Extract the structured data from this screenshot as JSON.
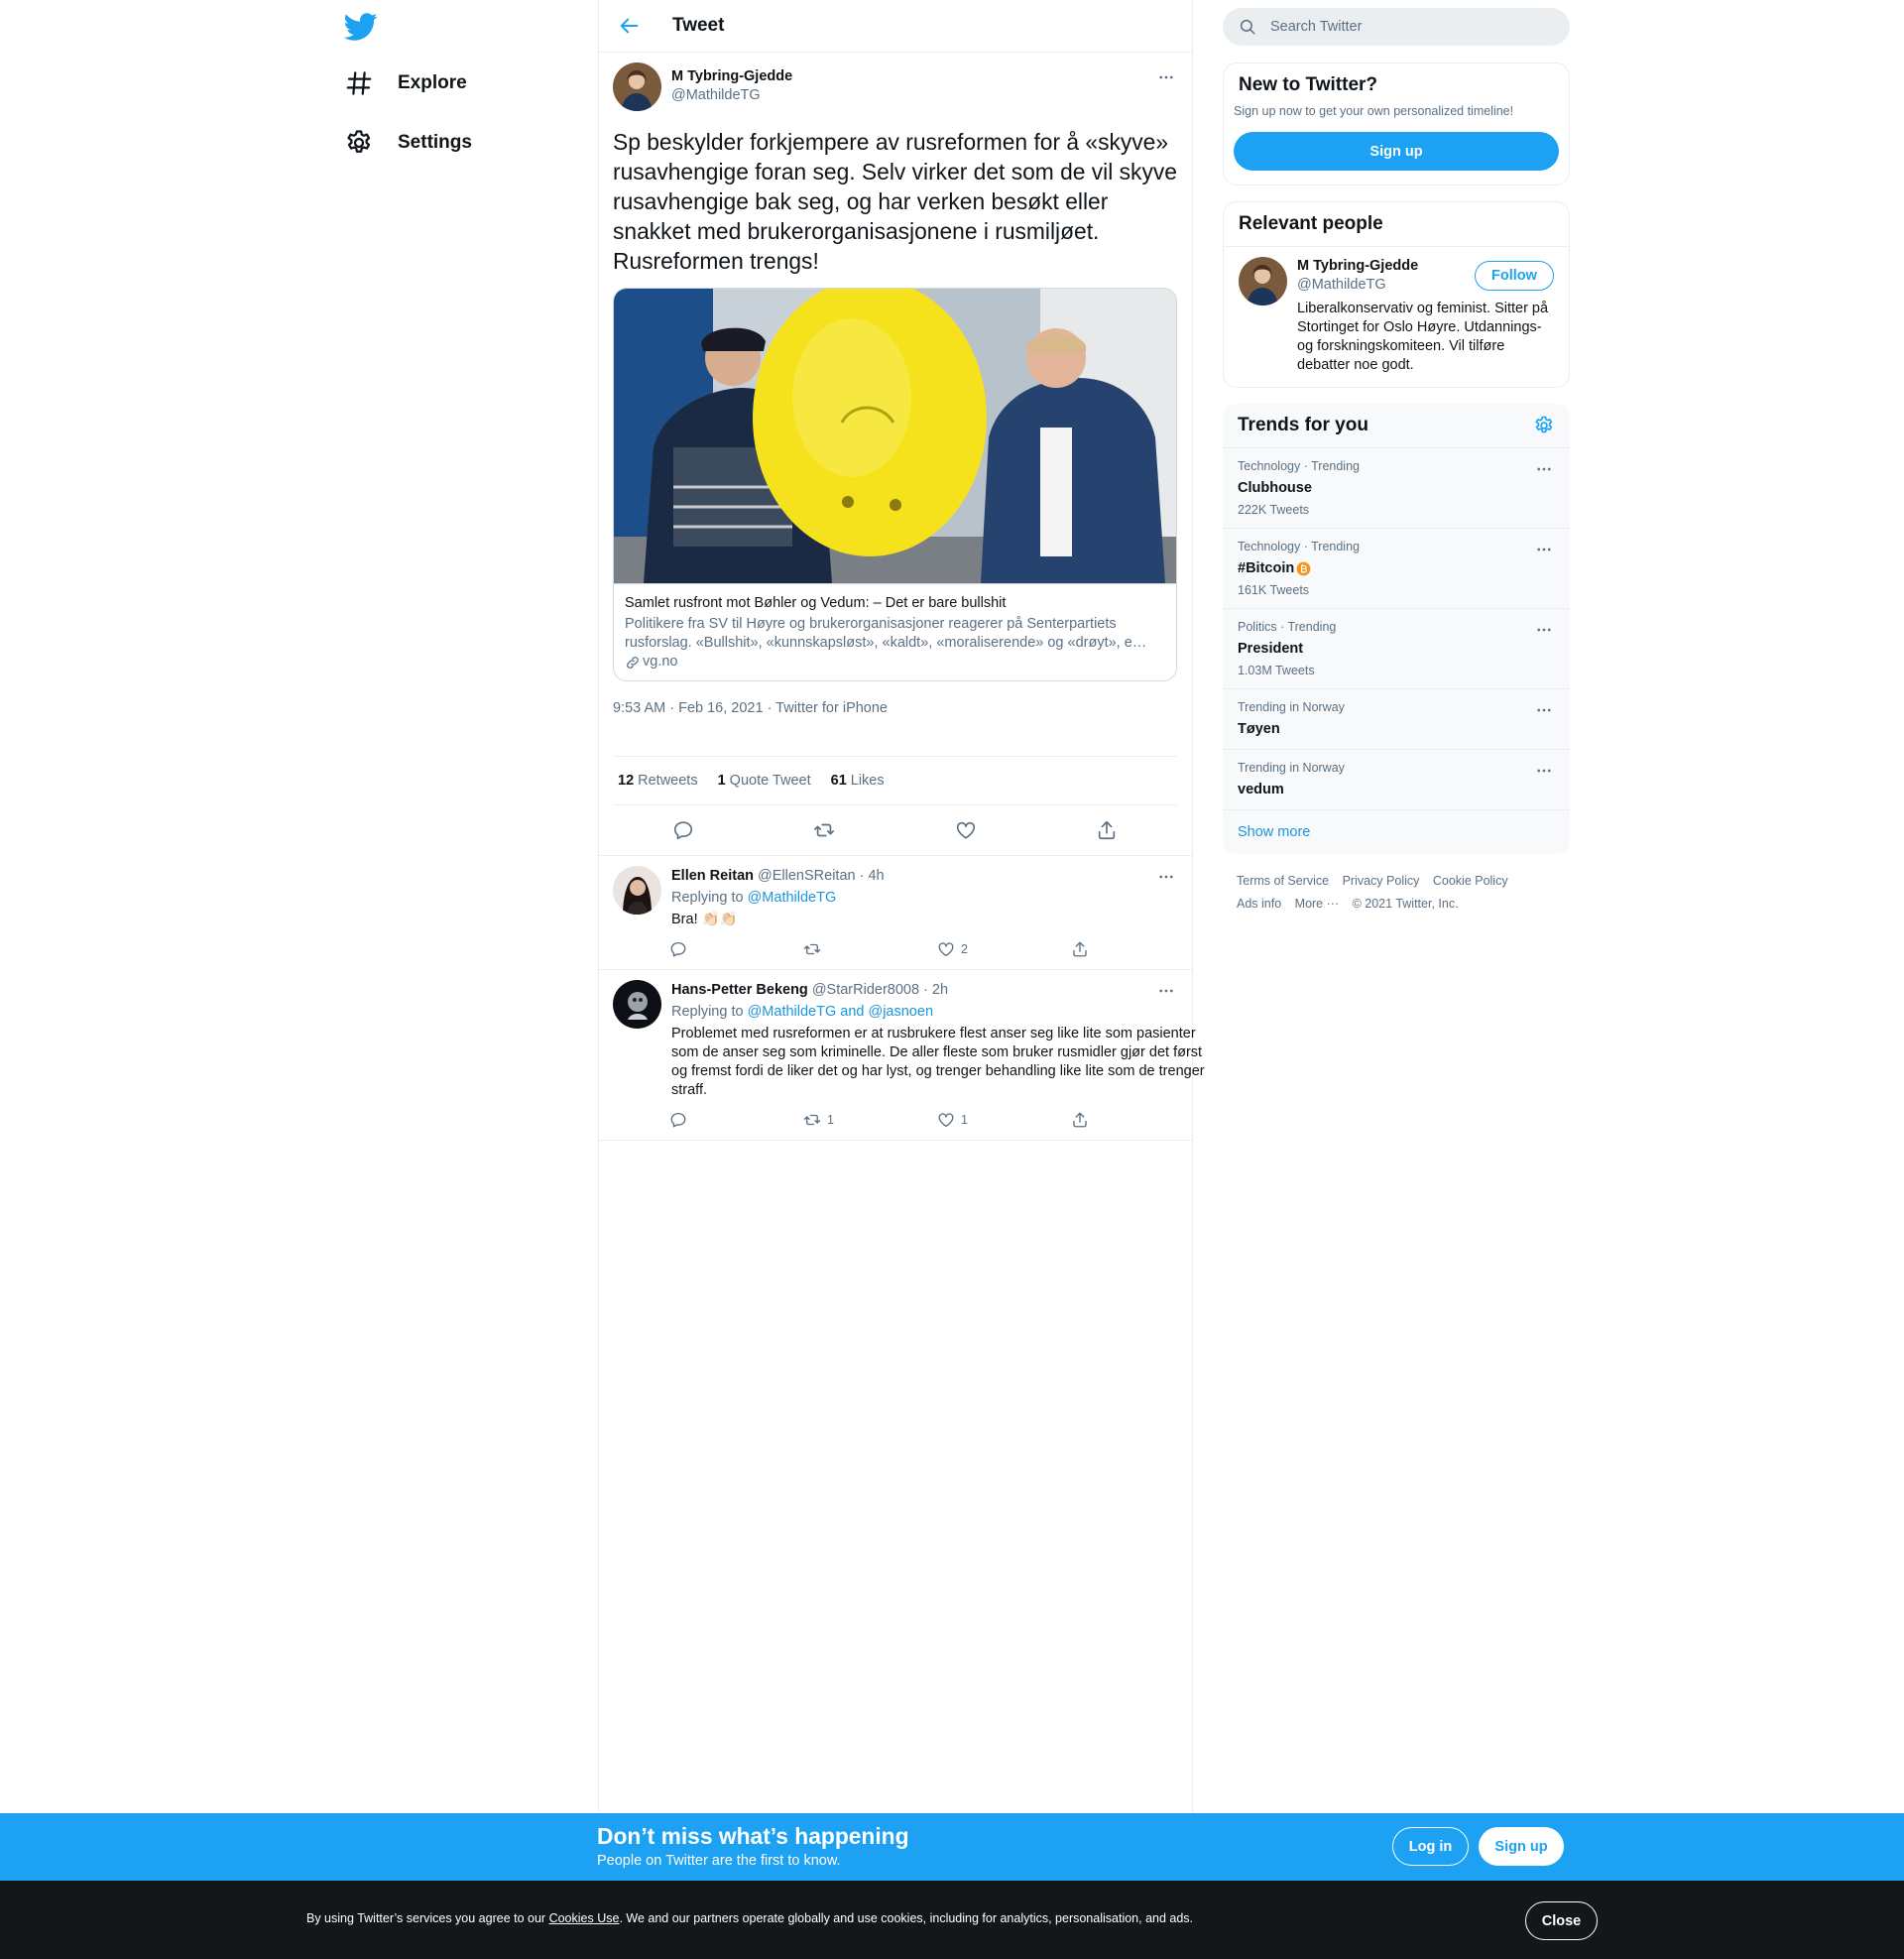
{
  "colors": {
    "brand": "#1da1f2",
    "link": "#1b95e0",
    "muted": "#5b7083",
    "text": "#0f1419",
    "banner": "#1da1f2",
    "cookie_bg": "#14171a"
  },
  "nav": {
    "logo": "twitter-bird-icon",
    "items": [
      {
        "label": "Explore",
        "icon": "hashtag-icon"
      },
      {
        "label": "Settings",
        "icon": "gear-icon"
      }
    ]
  },
  "header": {
    "title": "Tweet"
  },
  "tweet": {
    "author": {
      "name": "M Tybring-Gjedde",
      "handle": "@MathildeTG"
    },
    "text": "Sp beskylder forkjempere av rusreformen for å «skyve» rusavhengige foran seg. Selv virker det som de vil skyve rusavhengige bak seg, og har verken besøkt eller snakket med brukerorganisasjonene i rusmiljøet. Rusreformen trengs!",
    "card": {
      "title": "Samlet rusfront mot Bøhler og Vedum: – Det er bare bullshit",
      "description": "Politikere fra SV til Høyre og brukerorganisasjoner reagerer på Senterpartiets rusforslag. «Bullshit», «kunnskapsløst», «kaldt», «moraliserende» og «drøyt», e…",
      "domain": "vg.no"
    },
    "timestamp": "9:53 AM · Feb 16, 2021 · Twitter for iPhone",
    "stats": {
      "retweets_count": "12",
      "retweets_label": "Retweets",
      "quotes_count": "1",
      "quotes_label": "Quote Tweet",
      "likes_count": "61",
      "likes_label": "Likes"
    }
  },
  "replies": [
    {
      "name": "Ellen Reitan",
      "meta": "@EllenSReitan · 4h",
      "replying_prefix": "Replying to",
      "replying_to": "@MathildeTG",
      "text": "Bra! 👏🏻👏🏻",
      "reply_count": "",
      "retweet_count": "",
      "like_count": "2"
    },
    {
      "name": "Hans-Petter Bekeng",
      "meta": "@StarRider8008 · 2h",
      "replying_prefix": "Replying to",
      "replying_to": "@MathildeTG and @jasnoen",
      "text": "Problemet med rusreformen er at rusbrukere flest anser seg like lite som pasienter som de anser seg som kriminelle. De aller fleste som bruker rusmidler gjør det først og fremst fordi de liker det og har lyst, og trenger behandling like lite som de trenger straff.",
      "reply_count": "",
      "retweet_count": "1",
      "like_count": "1"
    }
  ],
  "sidebar": {
    "search_placeholder": "Search Twitter",
    "new_to_twitter": {
      "title": "New to Twitter?",
      "subtitle": "Sign up now to get your own personalized timeline!",
      "button": "Sign up"
    },
    "relevant_people": {
      "title": "Relevant people",
      "person": {
        "name": "M Tybring-Gjedde",
        "handle": "@MathildeTG",
        "bio": "Liberalkonservativ og feminist. Sitter på Stortinget for Oslo Høyre. Utdannings- og forskningskomiteen. Vil tilføre debatter noe godt.",
        "follow": "Follow"
      }
    },
    "trends": {
      "title": "Trends for you",
      "items": [
        {
          "category": "Technology · Trending",
          "name": "Clubhouse",
          "count": "222K Tweets"
        },
        {
          "category": "Technology · Trending",
          "name": "#Bitcoin",
          "count": "161K Tweets"
        },
        {
          "category": "Politics · Trending",
          "name": "President",
          "count": "1.03M Tweets"
        },
        {
          "category": "Trending in Norway",
          "name": "Tøyen",
          "count": ""
        },
        {
          "category": "Trending in Norway",
          "name": "vedum",
          "count": ""
        }
      ],
      "show_more": "Show more"
    },
    "footer": {
      "terms": "Terms of Service",
      "privacy": "Privacy Policy",
      "cookie": "Cookie Policy",
      "ads": "Ads info",
      "more": "More ···",
      "copyright": "© 2021 Twitter, Inc."
    }
  },
  "banner": {
    "title": "Don’t miss what’s happening",
    "subtitle": "People on Twitter are the first to know.",
    "login": "Log in",
    "signup": "Sign up"
  },
  "cookie_bar": {
    "text_before": "By using Twitter’s services you agree to our ",
    "link": "Cookies Use",
    "text_after": ". We and our partners operate globally and use cookies, including for analytics, personalisation, and ads.",
    "close": "Close"
  }
}
